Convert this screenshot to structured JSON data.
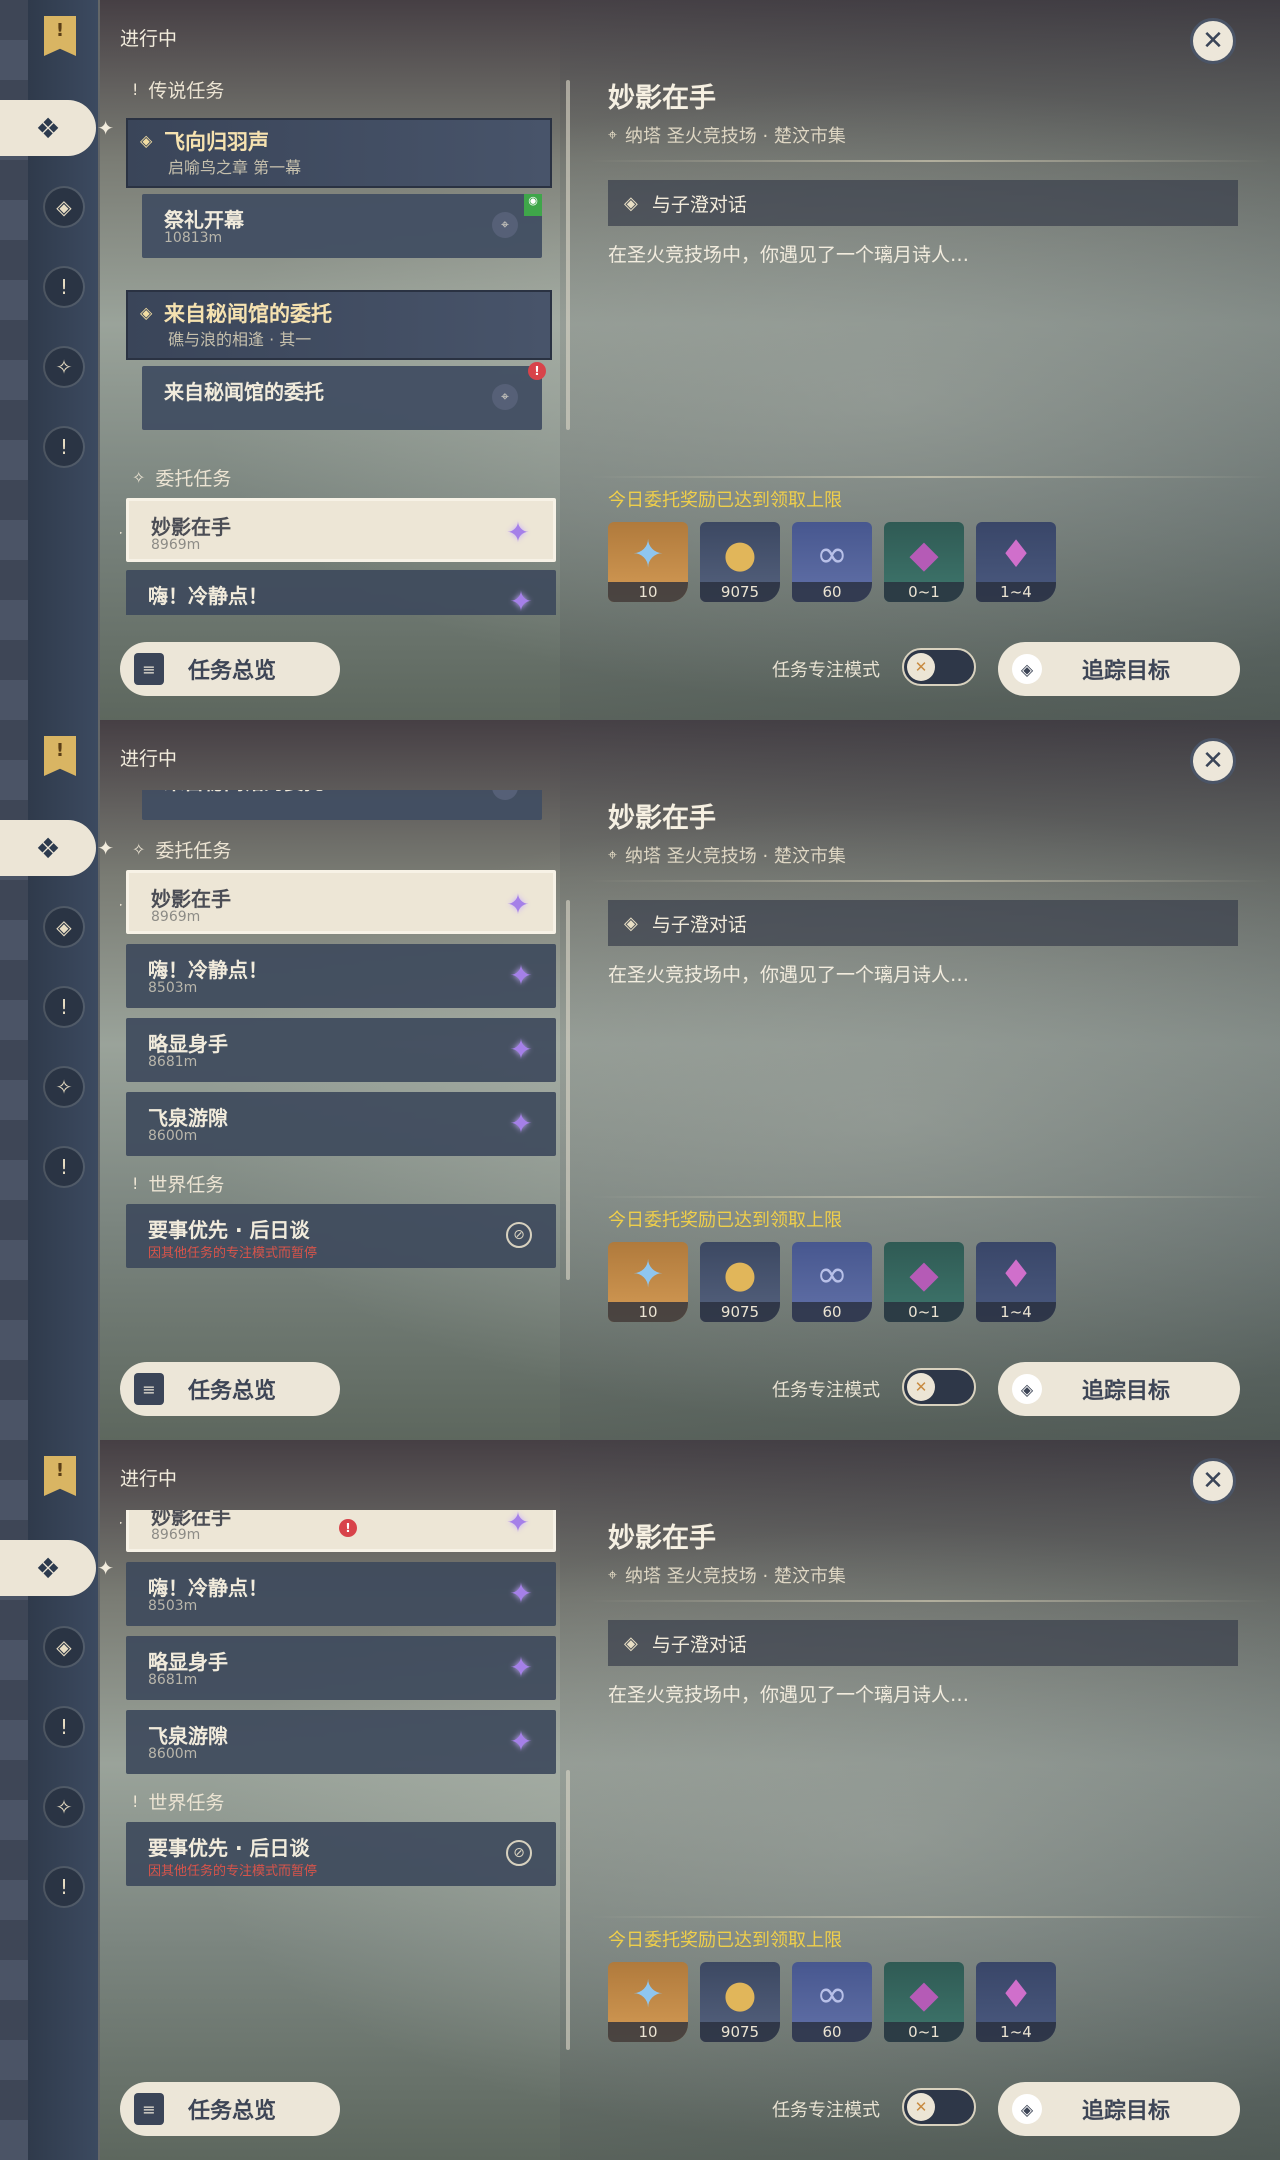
{
  "status_title": "进行中",
  "close_glyph": "✕",
  "overview_label": "任务总览",
  "focus_mode_label": "任务专注模式",
  "track_label": "追踪目标",
  "detail": {
    "title": "妙影在手",
    "location": "纳塔 圣火竞技场 · 楚汶市集",
    "objective": "与子澄对话",
    "description": "在圣火竞技场中，你遇见了一个璃月诗人…",
    "reward_note": "今日委托奖励已达到领取上限",
    "rewards": [
      {
        "icon": "primogem-icon",
        "qty": "10"
      },
      {
        "icon": "mora-icon",
        "qty": "9075"
      },
      {
        "icon": "companionship-icon",
        "qty": "60"
      },
      {
        "icon": "crystal-chunk-icon",
        "qty": "0~1"
      },
      {
        "icon": "crystal-cluster-icon",
        "qty": "1~4"
      }
    ]
  },
  "sections": {
    "archon": "传说任务",
    "commission": "委托任务",
    "world": "世界任务"
  },
  "quests": {
    "archon1": {
      "title": "飞向归羽声",
      "sub": "启喻鸟之章 第一幕"
    },
    "archon1_step": {
      "title": "祭礼开幕",
      "dist": "10813m"
    },
    "archon2": {
      "title": "来自秘闻馆的委托",
      "sub": "礁与浪的相逢 · 其一"
    },
    "archon2_step": {
      "title": "来自秘闻馆的委托"
    },
    "c1": {
      "title": "妙影在手",
      "dist": "8969m"
    },
    "c2": {
      "title": "嗨！冷静点！",
      "dist": "8503m"
    },
    "c3": {
      "title": "略显身手",
      "dist": "8681m"
    },
    "c4": {
      "title": "飞泉游隙",
      "dist": "8600m"
    },
    "c2_partial": {
      "title": "嗨！冷静点！",
      "dist": "8503m"
    },
    "w1": {
      "title": "要事优先 · 后日谈",
      "warn": "因其他任务的专注模式而暂停"
    }
  },
  "icons": {
    "commission": "✦",
    "pin": "⬤",
    "ban": "⊘",
    "diamond": "◈",
    "exclaim": "!"
  }
}
